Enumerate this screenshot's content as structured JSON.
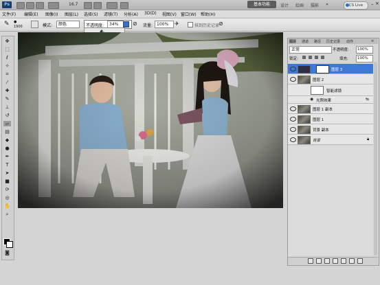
{
  "app": {
    "logo": "Ps",
    "zoom": "16.7",
    "workspace_button": "基本功能",
    "workspace_links": [
      "设计",
      "绘画",
      "摄影"
    ],
    "cs_live": "CS Live"
  },
  "menu": [
    "文件(F)",
    "编辑(E)",
    "图像(I)",
    "图层(L)",
    "选择(S)",
    "滤镜(T)",
    "分析(A)",
    "3D(D)",
    "视图(V)",
    "窗口(W)",
    "帮助(H)"
  ],
  "options": {
    "brush_size": "1900",
    "mode_label": "模式:",
    "mode_value": "颜色",
    "opacity_label": "不透明度:",
    "opacity_value": "34%",
    "flow_label": "流量:",
    "flow_value": "100%",
    "history_label": "抹到历史记录"
  },
  "layers_panel": {
    "tabs": [
      "图层",
      "通道",
      "路径",
      "历史记录",
      "动作"
    ],
    "blend_mode": "正常",
    "opacity_label": "不透明度:",
    "opacity_value": "100%",
    "lock_label": "锁定:",
    "fill_label": "填充:",
    "fill_value": "100%",
    "layers": [
      {
        "name": "图层 3",
        "selected": true
      },
      {
        "name": "图层 2",
        "selected": false
      },
      {
        "name": "智能滤镜",
        "selected": false
      },
      {
        "name": "光照效果",
        "selected": false
      },
      {
        "name": "图层 1 副本",
        "selected": false
      },
      {
        "name": "图层 1",
        "selected": false
      },
      {
        "name": "背景 副本",
        "selected": false
      },
      {
        "name": "背景",
        "selected": false
      }
    ]
  },
  "colors": {
    "selected_layer": "#3e79d6",
    "foreground": "#000000",
    "background": "#ffffff"
  }
}
